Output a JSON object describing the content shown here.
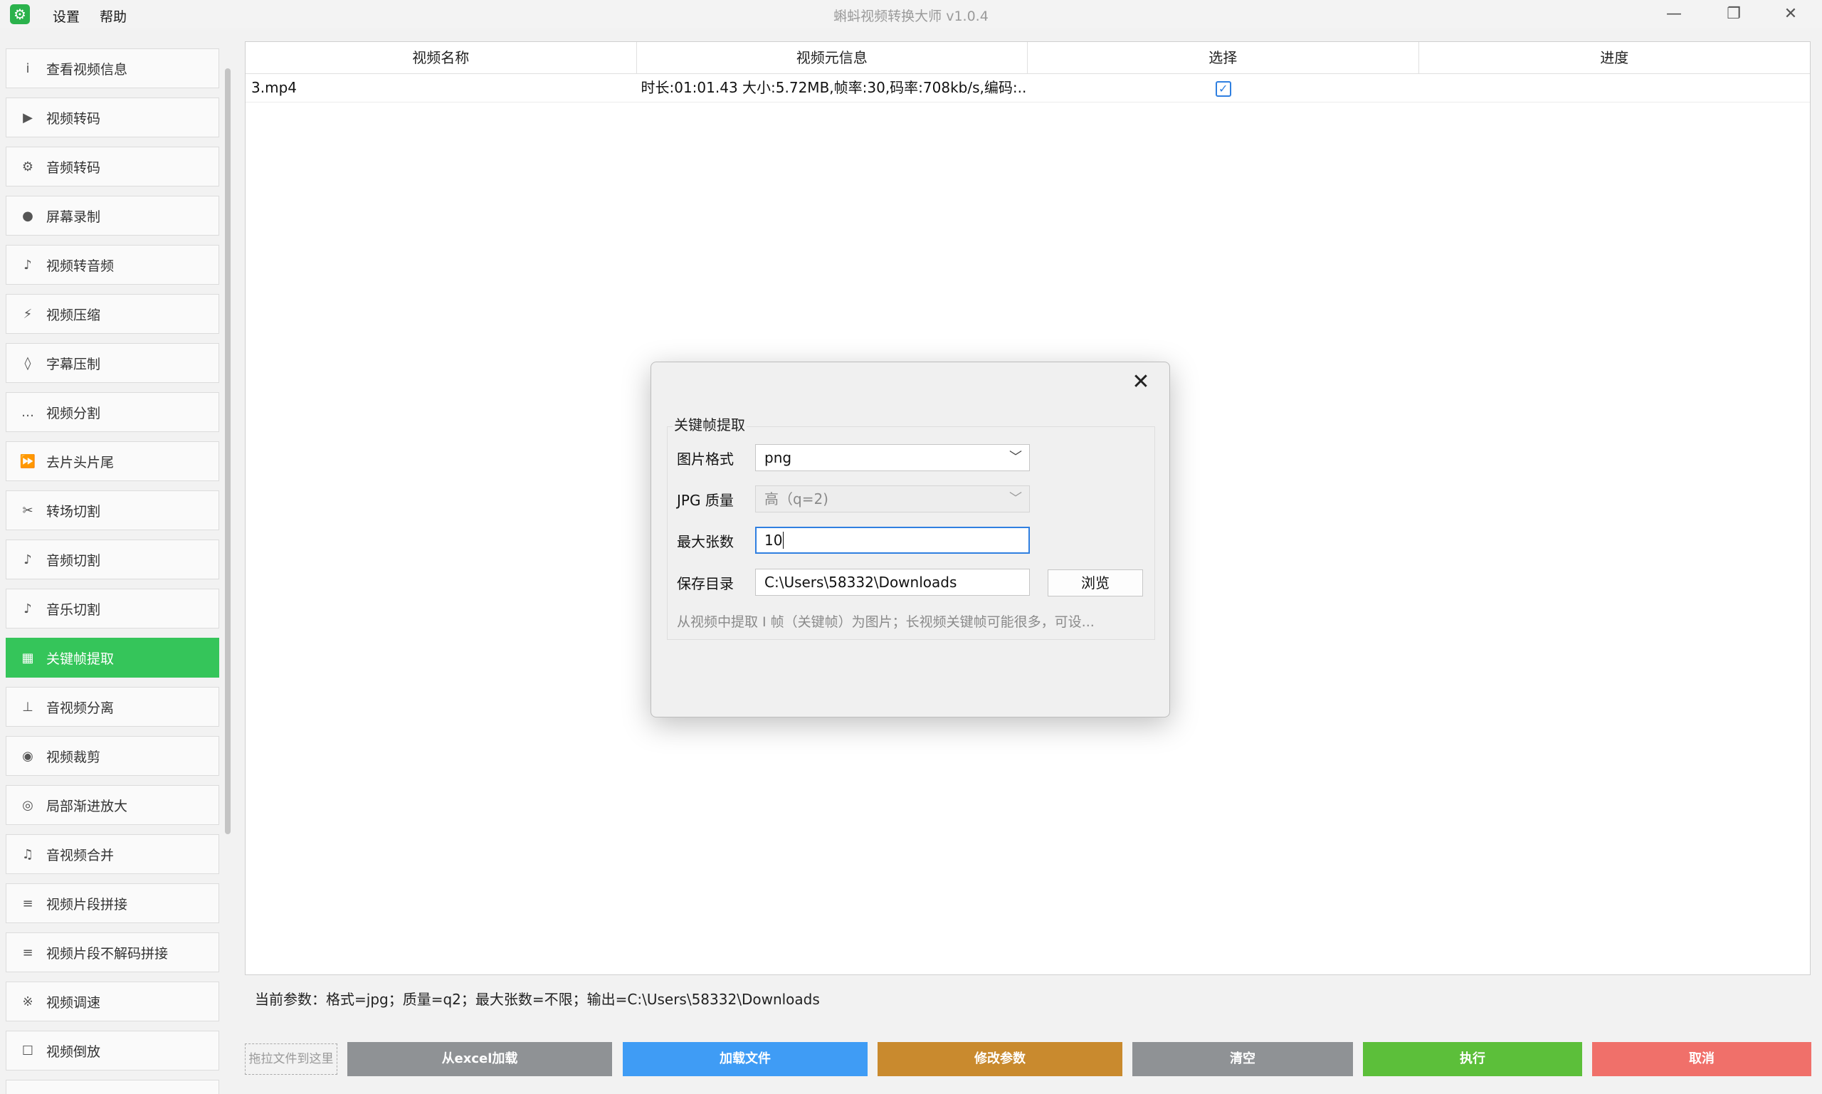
{
  "titlebar": {
    "menu": [
      "设置",
      "帮助"
    ],
    "title": "蝌蚪视频转换大师 v1.0.4",
    "minimize": "—",
    "restore": "❐",
    "close": "✕"
  },
  "sidebar": {
    "items": [
      {
        "icon": "i",
        "icon_name": "info-icon",
        "label": "查看视频信息"
      },
      {
        "icon": "▶",
        "icon_name": "play-icon",
        "label": "视频转码"
      },
      {
        "icon": "⚙",
        "icon_name": "gear-icon",
        "label": "音频转码"
      },
      {
        "icon": "●",
        "icon_name": "record-icon",
        "label": "屏幕录制"
      },
      {
        "icon": "♪",
        "icon_name": "music-note-icon",
        "label": "视频转音频"
      },
      {
        "icon": "⚡",
        "icon_name": "lightning-icon",
        "label": "视频压缩"
      },
      {
        "icon": "◊",
        "icon_name": "diamond-icon",
        "label": "字幕压制"
      },
      {
        "icon": "…",
        "icon_name": "ellipsis-icon",
        "label": "视频分割"
      },
      {
        "icon": "⏩",
        "icon_name": "fast-forward-icon",
        "label": "去片头片尾"
      },
      {
        "icon": "✂",
        "icon_name": "scissors-icon",
        "label": "转场切割"
      },
      {
        "icon": "♪",
        "icon_name": "music-note-icon",
        "label": "音频切割"
      },
      {
        "icon": "♪",
        "icon_name": "music-note-icon",
        "label": "音乐切割"
      },
      {
        "icon": "▦",
        "icon_name": "grid-icon",
        "label": "关键帧提取"
      },
      {
        "icon": "⊥",
        "icon_name": "split-icon",
        "label": "音视频分离"
      },
      {
        "icon": "◉",
        "icon_name": "crop-icon",
        "label": "视频裁剪"
      },
      {
        "icon": "◎",
        "icon_name": "zoom-icon",
        "label": "局部渐进放大"
      },
      {
        "icon": "♫",
        "icon_name": "music-notes-icon",
        "label": "音视频合并"
      },
      {
        "icon": "≡",
        "icon_name": "list-icon",
        "label": "视频片段拼接"
      },
      {
        "icon": "≡",
        "icon_name": "list-icon",
        "label": "视频片段不解码拼接"
      },
      {
        "icon": "※",
        "icon_name": "speed-icon",
        "label": "视频调速"
      },
      {
        "icon": "☐",
        "icon_name": "square-icon",
        "label": "视频倒放"
      }
    ],
    "active_index": 12
  },
  "table": {
    "columns": [
      "视频名称",
      "视频元信息",
      "选择",
      "进度"
    ],
    "rows": [
      {
        "name": "3.mp4",
        "meta": "时长:01:01.43 大小:5.72MB,帧率:30,码率:708kb/s,编码:...",
        "selected": "✓",
        "progress": ""
      }
    ]
  },
  "params_text": "当前参数：格式=jpg；质量=q2；最大张数=不限；输出=C:\\Users\\58332\\Downloads",
  "bottom": {
    "drop_hint": "拖拉文件到这里",
    "buttons": [
      {
        "label": "从excel加载",
        "color": "#8f9295"
      },
      {
        "label": "加载文件",
        "color": "#3f9cf5"
      },
      {
        "label": "修改参数",
        "color": "#c98a2e"
      },
      {
        "label": "清空",
        "color": "#8f9295"
      },
      {
        "label": "执行",
        "color": "#5cbf3a"
      },
      {
        "label": "取消",
        "color": "#f0706a"
      }
    ]
  },
  "dialog": {
    "close": "✕",
    "group_title": "关键帧提取",
    "format_label": "图片格式",
    "format_value": "png",
    "quality_label": "JPG 质量",
    "quality_value": "高（q=2)",
    "max_label": "最大张数",
    "max_value": "10",
    "dir_label": "保存目录",
    "dir_value": "C:\\Users\\58332\\Downloads",
    "browse_label": "浏览",
    "hint": "从视频中提取 I 帧（关键帧）为图片；长视频关键帧可能很多，可设...",
    "chevron": "﹀"
  }
}
